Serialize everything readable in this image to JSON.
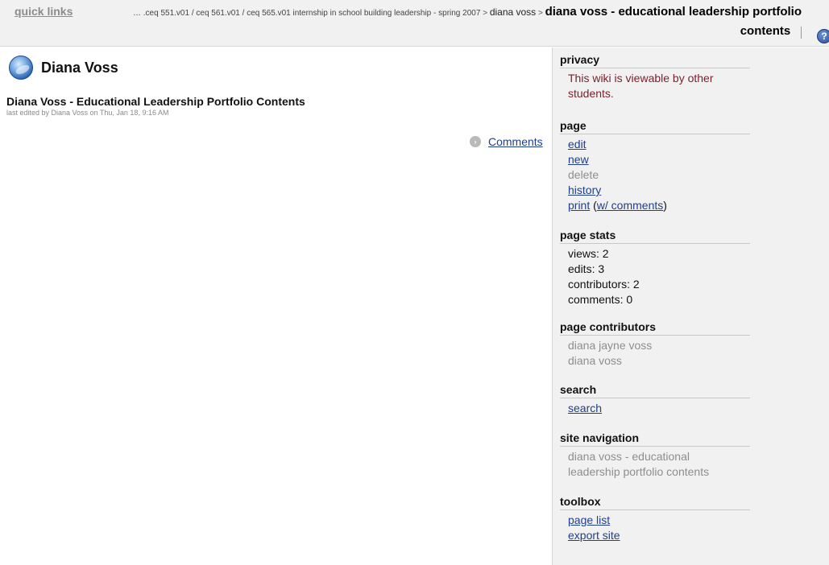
{
  "topbar": {
    "quick_links": "quick links",
    "breadcrumb_path": "… .ceq 551.v01 / ceq 561.v01 / ceq 565.v01 internship in school building leadership - spring 2007",
    "breadcrumb_sep": ">",
    "breadcrumb_user": "diana voss",
    "breadcrumb_current": "diana voss - educational leadership portfolio contents",
    "help_icon_glyph": "?"
  },
  "main": {
    "user_name": "Diana Voss",
    "page_title": "Diana Voss - Educational Leadership Portfolio Contents",
    "last_edited": "last edited by Diana Voss on Thu, Jan 18, 9:16 AM",
    "comments_link": "Comments",
    "comments_arrow_glyph": "›"
  },
  "sidebar": {
    "privacy": {
      "heading": "privacy",
      "text": "This wiki is viewable by other students."
    },
    "page": {
      "heading": "page",
      "edit": "edit",
      "new": "new",
      "delete": "delete",
      "history": "history",
      "print": "print",
      "print_comments_open": "(",
      "print_comments": "w/ comments",
      "print_comments_close": ")"
    },
    "page_stats": {
      "heading": "page stats",
      "views": "views: 2",
      "edits": "edits: 3",
      "contributors": "contributors: 2",
      "comments": "comments: 0"
    },
    "page_contributors": {
      "heading": "page contributors",
      "items": [
        "diana jayne voss",
        "diana voss"
      ]
    },
    "search": {
      "heading": "search",
      "link": "search"
    },
    "site_navigation": {
      "heading": "site navigation",
      "item": "diana voss - educational leadership portfolio contents"
    },
    "toolbox": {
      "heading": "toolbox",
      "page_list": "page list",
      "export_site": "export site"
    }
  },
  "colors": {
    "link": "#1f3f8a",
    "privacy_text": "#7a1f2a",
    "panel_bg": "#f1f1f1",
    "muted": "#8e8e8e"
  }
}
